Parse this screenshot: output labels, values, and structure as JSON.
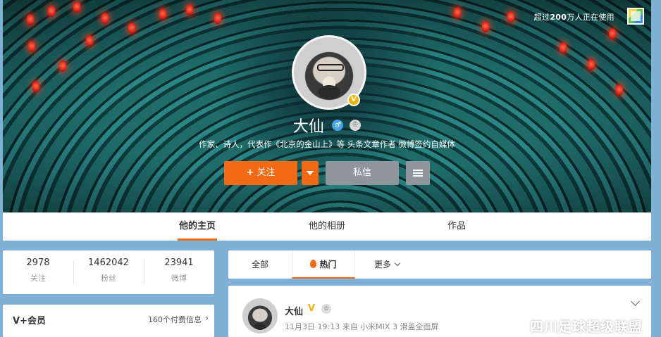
{
  "header": {
    "online_prefix": "超过",
    "online_count": "200",
    "online_suffix": "万人正在使用",
    "name": "大仙",
    "verified_badge": "V",
    "intro": "作家、诗人，代表作《北京的金山上》等 头条文章作者 微博签约自媒体",
    "follow_plus": "+",
    "follow_label": "关注",
    "message_label": "私信",
    "gender_symbol": "♂",
    "crown_symbol": "♔"
  },
  "tabs": [
    {
      "label": "他的主页",
      "active": true
    },
    {
      "label": "他的相册",
      "active": false
    },
    {
      "label": "作品",
      "active": false
    }
  ],
  "stats": [
    {
      "value": "2978",
      "label": "关注"
    },
    {
      "value": "1462042",
      "label": "粉丝"
    },
    {
      "value": "23941",
      "label": "微博"
    }
  ],
  "vip": {
    "title": "V+会员",
    "info": "160个付费信息",
    "chevron": "›"
  },
  "feed_filter": {
    "all": "全部",
    "hot": "热门",
    "more": "更多"
  },
  "post": {
    "author": "大仙",
    "verified": "V",
    "crown": "♔",
    "meta": "11月3日 19:13 来自 小米MIX 3 滑盖全面屏"
  },
  "watermark": {
    "text": "四川足球超级联盟"
  },
  "colors": {
    "accent": "#f36a14",
    "secondary_button": "#8e969b",
    "verified_gold": "#f0b400",
    "page_bg": "#7fb1d6"
  },
  "icons": [
    "skin-icon",
    "verified-badge-icon",
    "gender-male-icon",
    "crown-icon",
    "plus-icon",
    "dropdown-arrow-icon",
    "menu-icon",
    "fire-icon",
    "chevron-down-icon",
    "chevron-right-icon",
    "wechat-icon"
  ]
}
